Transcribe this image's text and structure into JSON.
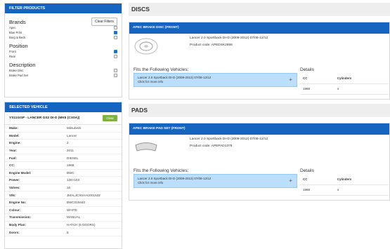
{
  "filter": {
    "title": "FILTER PRODUCTS",
    "clear_label": "Clear Filters",
    "groups": [
      {
        "title": "Brands",
        "items": [
          {
            "label": "Apec",
            "checked": false
          },
          {
            "label": "Blue Print",
            "checked": true
          },
          {
            "label": "Borg & Beck",
            "checked": false
          }
        ]
      },
      {
        "title": "Position",
        "items": [
          {
            "label": "Front",
            "checked": true
          },
          {
            "label": "Rear",
            "checked": false
          }
        ]
      },
      {
        "title": "Description",
        "items": [
          {
            "label": "Brake Disc",
            "checked": false
          },
          {
            "label": "Brake Pad Set",
            "checked": false
          }
        ]
      }
    ]
  },
  "vehicle": {
    "title": "SELECTED VEHICLE",
    "reg": "YS11GGP - LANCER GS2 DI-D (MK5 (CX0A))",
    "clear_label": "Clear",
    "rows": [
      {
        "k": "Make:",
        "v": "Mitsubishi"
      },
      {
        "k": "Model:",
        "v": "Lancer"
      },
      {
        "k": "Engine:",
        "v": "2"
      },
      {
        "k": "Year:",
        "v": "2011"
      },
      {
        "k": "Fuel:",
        "v": "DIESEL"
      },
      {
        "k": "CC:",
        "v": "1968"
      },
      {
        "k": "Engine Model:",
        "v": "BWC"
      },
      {
        "k": "Power:",
        "v": "136>103"
      },
      {
        "k": "Valves:",
        "v": "16"
      },
      {
        "k": "VIN:",
        "v": "JMALJCX0AAU001522"
      },
      {
        "k": "Engine No:",
        "v": "BWC019440"
      },
      {
        "k": "Colour:",
        "v": "WHITE"
      },
      {
        "k": "Transmission:",
        "v": "MANUAL"
      },
      {
        "k": "Body Plan:",
        "v": "HATCH (5 DOORS)"
      },
      {
        "k": "Doors:",
        "v": "5"
      }
    ]
  },
  "sections": [
    {
      "title": "DISCS",
      "product": {
        "head": "APEC BRAKE DISC (FRONT)",
        "title": "Lancer 2.0 Sportback DI-D (2008-2012) 07/08-12/12",
        "code": "Product code: APEDSK2666",
        "image_icon": "brake-disc-icon",
        "fits_label": "Fits the Following Vehicles:",
        "vehicle": "Lancer 2.0 Sportback DI-D (2008-2012) 07/08-12/12",
        "vehicle_more": "Click for more info",
        "details_label": "Details",
        "cols": [
          "CC",
          "Cylinders"
        ],
        "vals": [
          "1968",
          "4"
        ]
      }
    },
    {
      "title": "PADS",
      "product": {
        "head": "APEC BRAKE PAD SET (FRONT)",
        "title": "Lancer 2.0 Sportback DI-D (2008-2012) 07/08-12/12",
        "code": "Product code: APEPAD1376",
        "image_icon": "brake-pad-icon",
        "fits_label": "Fits the Following Vehicles:",
        "vehicle": "Lancer 2.0 Sportback DI-D (2008-2012) 07/08-12/12",
        "vehicle_more": "Click for more info",
        "details_label": "Details",
        "cols": [
          "CC",
          "Cylinders"
        ],
        "vals": [
          "1968",
          "4"
        ]
      }
    }
  ]
}
